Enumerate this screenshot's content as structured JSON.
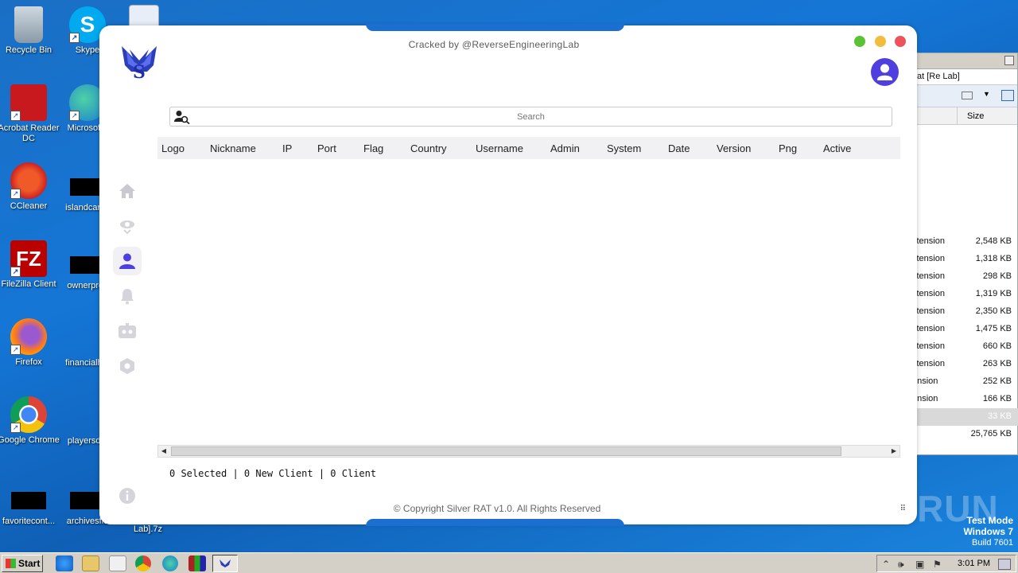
{
  "desktop": {
    "icons": [
      {
        "label": "Recycle Bin"
      },
      {
        "label": "Skype"
      },
      {
        "label": "Acrobat Reader DC"
      },
      {
        "label": "Microsoft I"
      },
      {
        "label": "CCleaner"
      },
      {
        "label": "islandcard.j"
      },
      {
        "label": "FileZilla Client"
      },
      {
        "label": "ownerpres"
      },
      {
        "label": "Firefox"
      },
      {
        "label": "financialhot"
      },
      {
        "label": "Google Chrome"
      },
      {
        "label": "playersdie"
      },
      {
        "label": "favoritecont..."
      },
      {
        "label": "archivesflo"
      },
      {
        "label": "Lab].7z"
      }
    ]
  },
  "background_window": {
    "address": "at [Re Lab]",
    "size_header": "Size",
    "rows": [
      {
        "type": "xtension",
        "size": "2,548 KB"
      },
      {
        "type": "xtension",
        "size": "1,318 KB"
      },
      {
        "type": "xtension",
        "size": "298 KB"
      },
      {
        "type": "xtension",
        "size": "1,319 KB"
      },
      {
        "type": "xtension",
        "size": "2,350 KB"
      },
      {
        "type": "xtension",
        "size": "1,475 KB"
      },
      {
        "type": "xtension",
        "size": "660 KB"
      },
      {
        "type": "xtension",
        "size": "263 KB"
      },
      {
        "type": "ension",
        "size": "252 KB"
      },
      {
        "type": "ension",
        "size": "166 KB"
      },
      {
        "type": "",
        "size": "33 KB"
      },
      {
        "type": "",
        "size": "25,765 KB"
      }
    ]
  },
  "app": {
    "title": "Cracked by @ReverseEngineeringLab",
    "search_placeholder": "Search",
    "columns": [
      "Logo",
      "Nickname",
      "IP",
      "Port",
      "Flag",
      "Country",
      "Username",
      "Admin",
      "System",
      "Date",
      "Version",
      "Png",
      "Active"
    ],
    "status": "0 Selected | 0 New Client | 0 Client",
    "footer": "© Copyright Silver RAT v1.0. All Rights Reserved",
    "sidebar": [
      "home-icon",
      "eye-icon",
      "user-icon",
      "bell-icon",
      "robot-icon",
      "settings-icon"
    ],
    "info_icon": "info-icon",
    "window_dots": {
      "green": "#5bc236",
      "yellow": "#f2bc3c",
      "red": "#f0525a"
    },
    "accent": "#4f3fe0"
  },
  "overlay": {
    "testmode_line1": "Test Mode",
    "testmode_line2": "Windows 7",
    "testmode_line3": "Build 7601",
    "watermark": "ANY RUN"
  },
  "taskbar": {
    "start_label": "Start",
    "clock": "3:01 PM"
  }
}
